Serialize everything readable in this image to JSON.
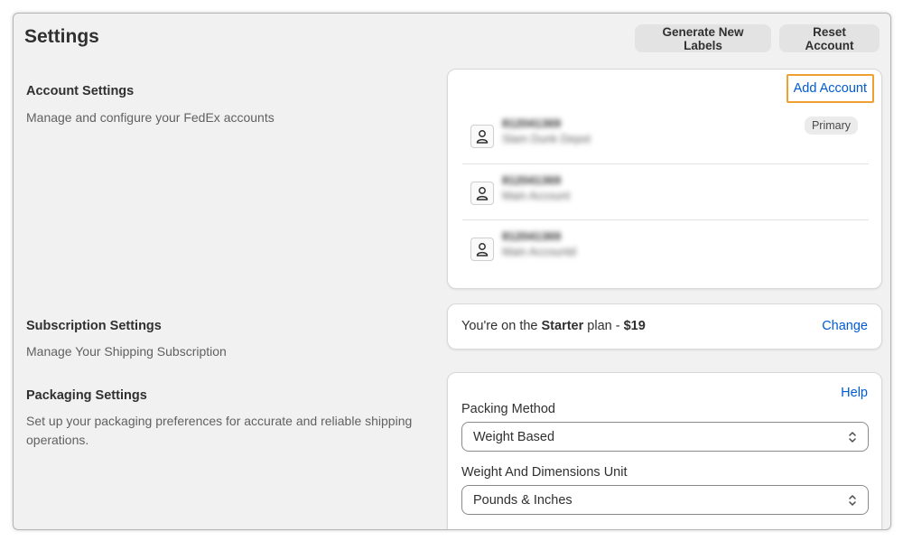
{
  "page": {
    "title": "Settings",
    "actions": {
      "generate_labels": "Generate New Labels",
      "reset_account": "Reset Account"
    }
  },
  "account_settings": {
    "title": "Account Settings",
    "description": "Manage and configure your FedEx accounts",
    "add_account": "Add Account",
    "accounts": [
      {
        "number": "812041369",
        "name": "Slam Dunk Depot",
        "badge": "Primary"
      },
      {
        "number": "812041369",
        "name": "Main Account"
      },
      {
        "number": "812041369",
        "name": "Main Accountd"
      }
    ]
  },
  "subscription_settings": {
    "title": "Subscription Settings",
    "description": "Manage Your Shipping Subscription",
    "prefix": "You're on the ",
    "plan": "Starter",
    "middle": " plan - ",
    "price": "$19",
    "change": "Change"
  },
  "packaging_settings": {
    "title": "Packaging Settings",
    "description": "Set up your packaging preferences for accurate and reliable shipping operations.",
    "help": "Help",
    "packing_method_label": "Packing Method",
    "packing_method_value": "Weight Based",
    "unit_label": "Weight And Dimensions Unit",
    "unit_value": "Pounds & Inches"
  },
  "icons": {
    "account": "person-icon",
    "select": "chevron-up-down-icon"
  },
  "colors": {
    "link": "#005bd3",
    "highlight": "#f0a030",
    "background": "#f1f1f1"
  }
}
